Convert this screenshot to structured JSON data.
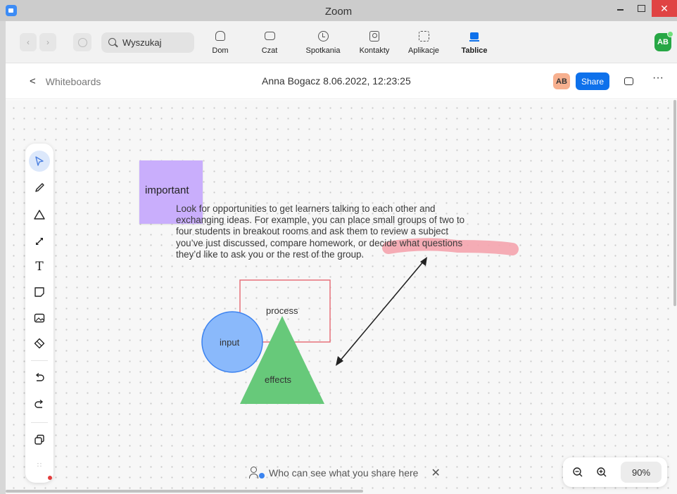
{
  "window": {
    "title": "Zoom",
    "close_glyph": "✕"
  },
  "nav": {
    "back_glyph": "‹",
    "forward_glyph": "›",
    "search": {
      "placeholder": "Wyszukaj"
    },
    "tabs": [
      {
        "label": "Dom",
        "icon": "home-icon"
      },
      {
        "label": "Czat",
        "icon": "chat-icon"
      },
      {
        "label": "Spotkania",
        "icon": "clock-icon"
      },
      {
        "label": "Kontakty",
        "icon": "contacts-icon"
      },
      {
        "label": "Aplikacje",
        "icon": "apps-icon"
      },
      {
        "label": "Tablice",
        "icon": "whiteboard-icon",
        "active": true
      }
    ],
    "user_initials": "AB"
  },
  "header": {
    "back_glyph": "<",
    "back_label": "Whiteboards",
    "title": "Anna Bogacz 8.06.2022, 12:23:25",
    "owner_initials": "AB",
    "share_label": "Share",
    "more_glyph": "···"
  },
  "toolbar": {
    "text_glyph": "T",
    "more_glyph": "∷",
    "tools": [
      "select",
      "pen",
      "shape",
      "connector",
      "text",
      "sticky-note",
      "image",
      "eraser",
      "undo",
      "redo",
      "layers",
      "more"
    ]
  },
  "board": {
    "sticky_note": {
      "text": "important",
      "color": "#c9aefc"
    },
    "body_text": "Look for opportunities to get learners talking to each other and\nexchanging ideas. For example, you can place small groups of two to\nfour students in breakout rooms and ask them to review a subject\nyou’ve just discussed, compare homework, or decide what questions\nthey’d like to ask you or the rest of the group.",
    "shapes": {
      "process_label": "process",
      "input_label": "input",
      "effects_label": "effects",
      "rectangle_color": "#e7707a",
      "circle_color": "#8ab9fb",
      "triangle_color": "#67c97a",
      "highlight_color": "#f4a3ad"
    }
  },
  "footer": {
    "share_hint": "Who can see what you share here",
    "hint_close_glyph": "✕",
    "zoom_level": "90%"
  }
}
